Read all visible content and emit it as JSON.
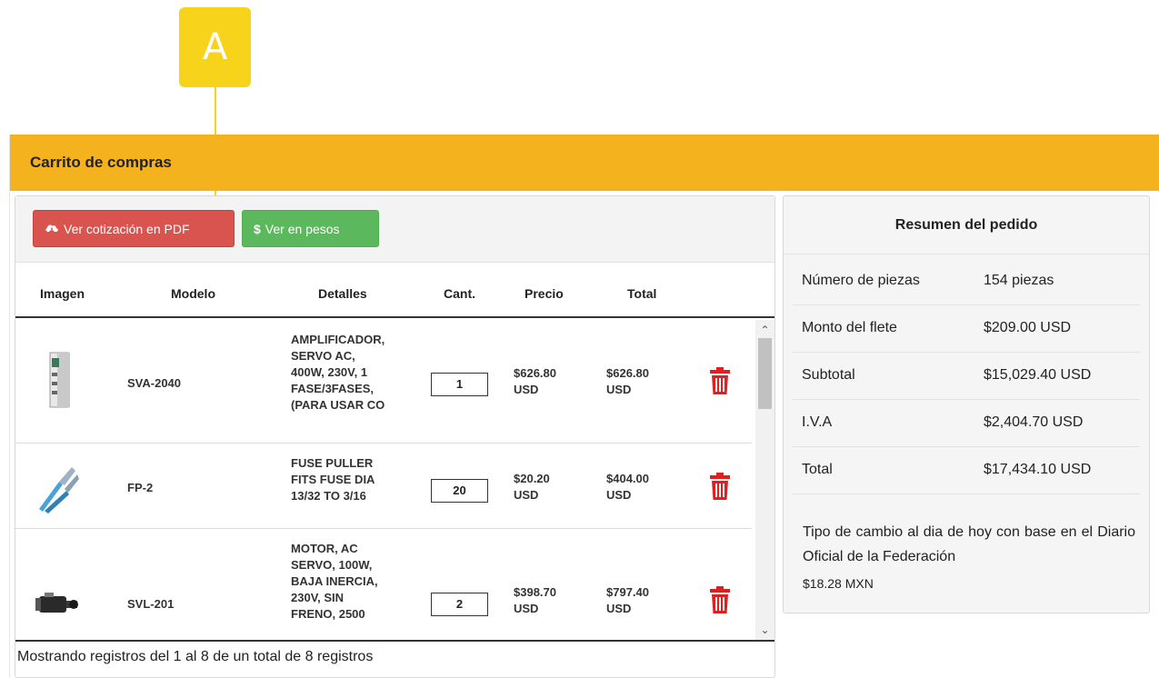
{
  "callout": {
    "label": "A"
  },
  "panel": {
    "title": "Carrito de compras"
  },
  "toolbar": {
    "pdf_label": "Ver cotización en PDF",
    "pesos_label": "Ver en pesos",
    "pesos_symbol": "$",
    "pdf_icon": "cloud-download-icon",
    "pesos_icon": "dollar-icon"
  },
  "table": {
    "headers": [
      "Imagen",
      "Modelo",
      "Detalles",
      "Cant.",
      "Precio",
      "Total"
    ],
    "rows": [
      {
        "image_icon": "servo-amplifier-image",
        "model": "SVA-2040",
        "details": [
          "AMPLIFICADOR,",
          "SERVO AC,",
          "400W, 230V, 1",
          "FASE/3FASES,",
          "(PARA USAR CO"
        ],
        "qty": "1",
        "price": [
          "$626.80",
          "USD"
        ],
        "total": [
          "$626.80",
          "USD"
        ]
      },
      {
        "image_icon": "fuse-puller-image",
        "model": "FP-2",
        "details": [
          "FUSE PULLER",
          "FITS FUSE DIA",
          "13/32 TO 3/16"
        ],
        "qty": "20",
        "price": [
          "$20.20",
          "USD"
        ],
        "total": [
          "$404.00",
          "USD"
        ]
      },
      {
        "image_icon": "servo-motor-image",
        "model": "SVL-201",
        "details": [
          "MOTOR, AC",
          "SERVO, 100W,",
          "BAJA INERCIA,",
          "230V, SIN",
          "FRENO, 2500"
        ],
        "qty": "2",
        "price": [
          "$398.70",
          "USD"
        ],
        "total": [
          "$797.40",
          "USD"
        ]
      }
    ],
    "footer": "Mostrando registros del 1 al 8 de un total de 8 registros"
  },
  "summary": {
    "title": "Resumen del pedido",
    "rows": [
      {
        "label": "Número de piezas",
        "value": "154 piezas"
      },
      {
        "label": "Monto del flete",
        "value": "$209.00 USD"
      },
      {
        "label": "Subtotal",
        "value": "$15,029.40 USD"
      },
      {
        "label": "I.V.A",
        "value": "$2,404.70 USD"
      },
      {
        "label": "Total",
        "value": "$17,434.10 USD"
      }
    ],
    "note": "Tipo de cambio al dia de hoy con base en el Diario Oficial de la Federación",
    "rate": "$18.28 MXN"
  },
  "colors": {
    "header": "#f5b21f",
    "callout": "#f8d31c",
    "pdf_button": "#d9534f",
    "pesos_button": "#5cb85c",
    "trash": "#e02020"
  }
}
